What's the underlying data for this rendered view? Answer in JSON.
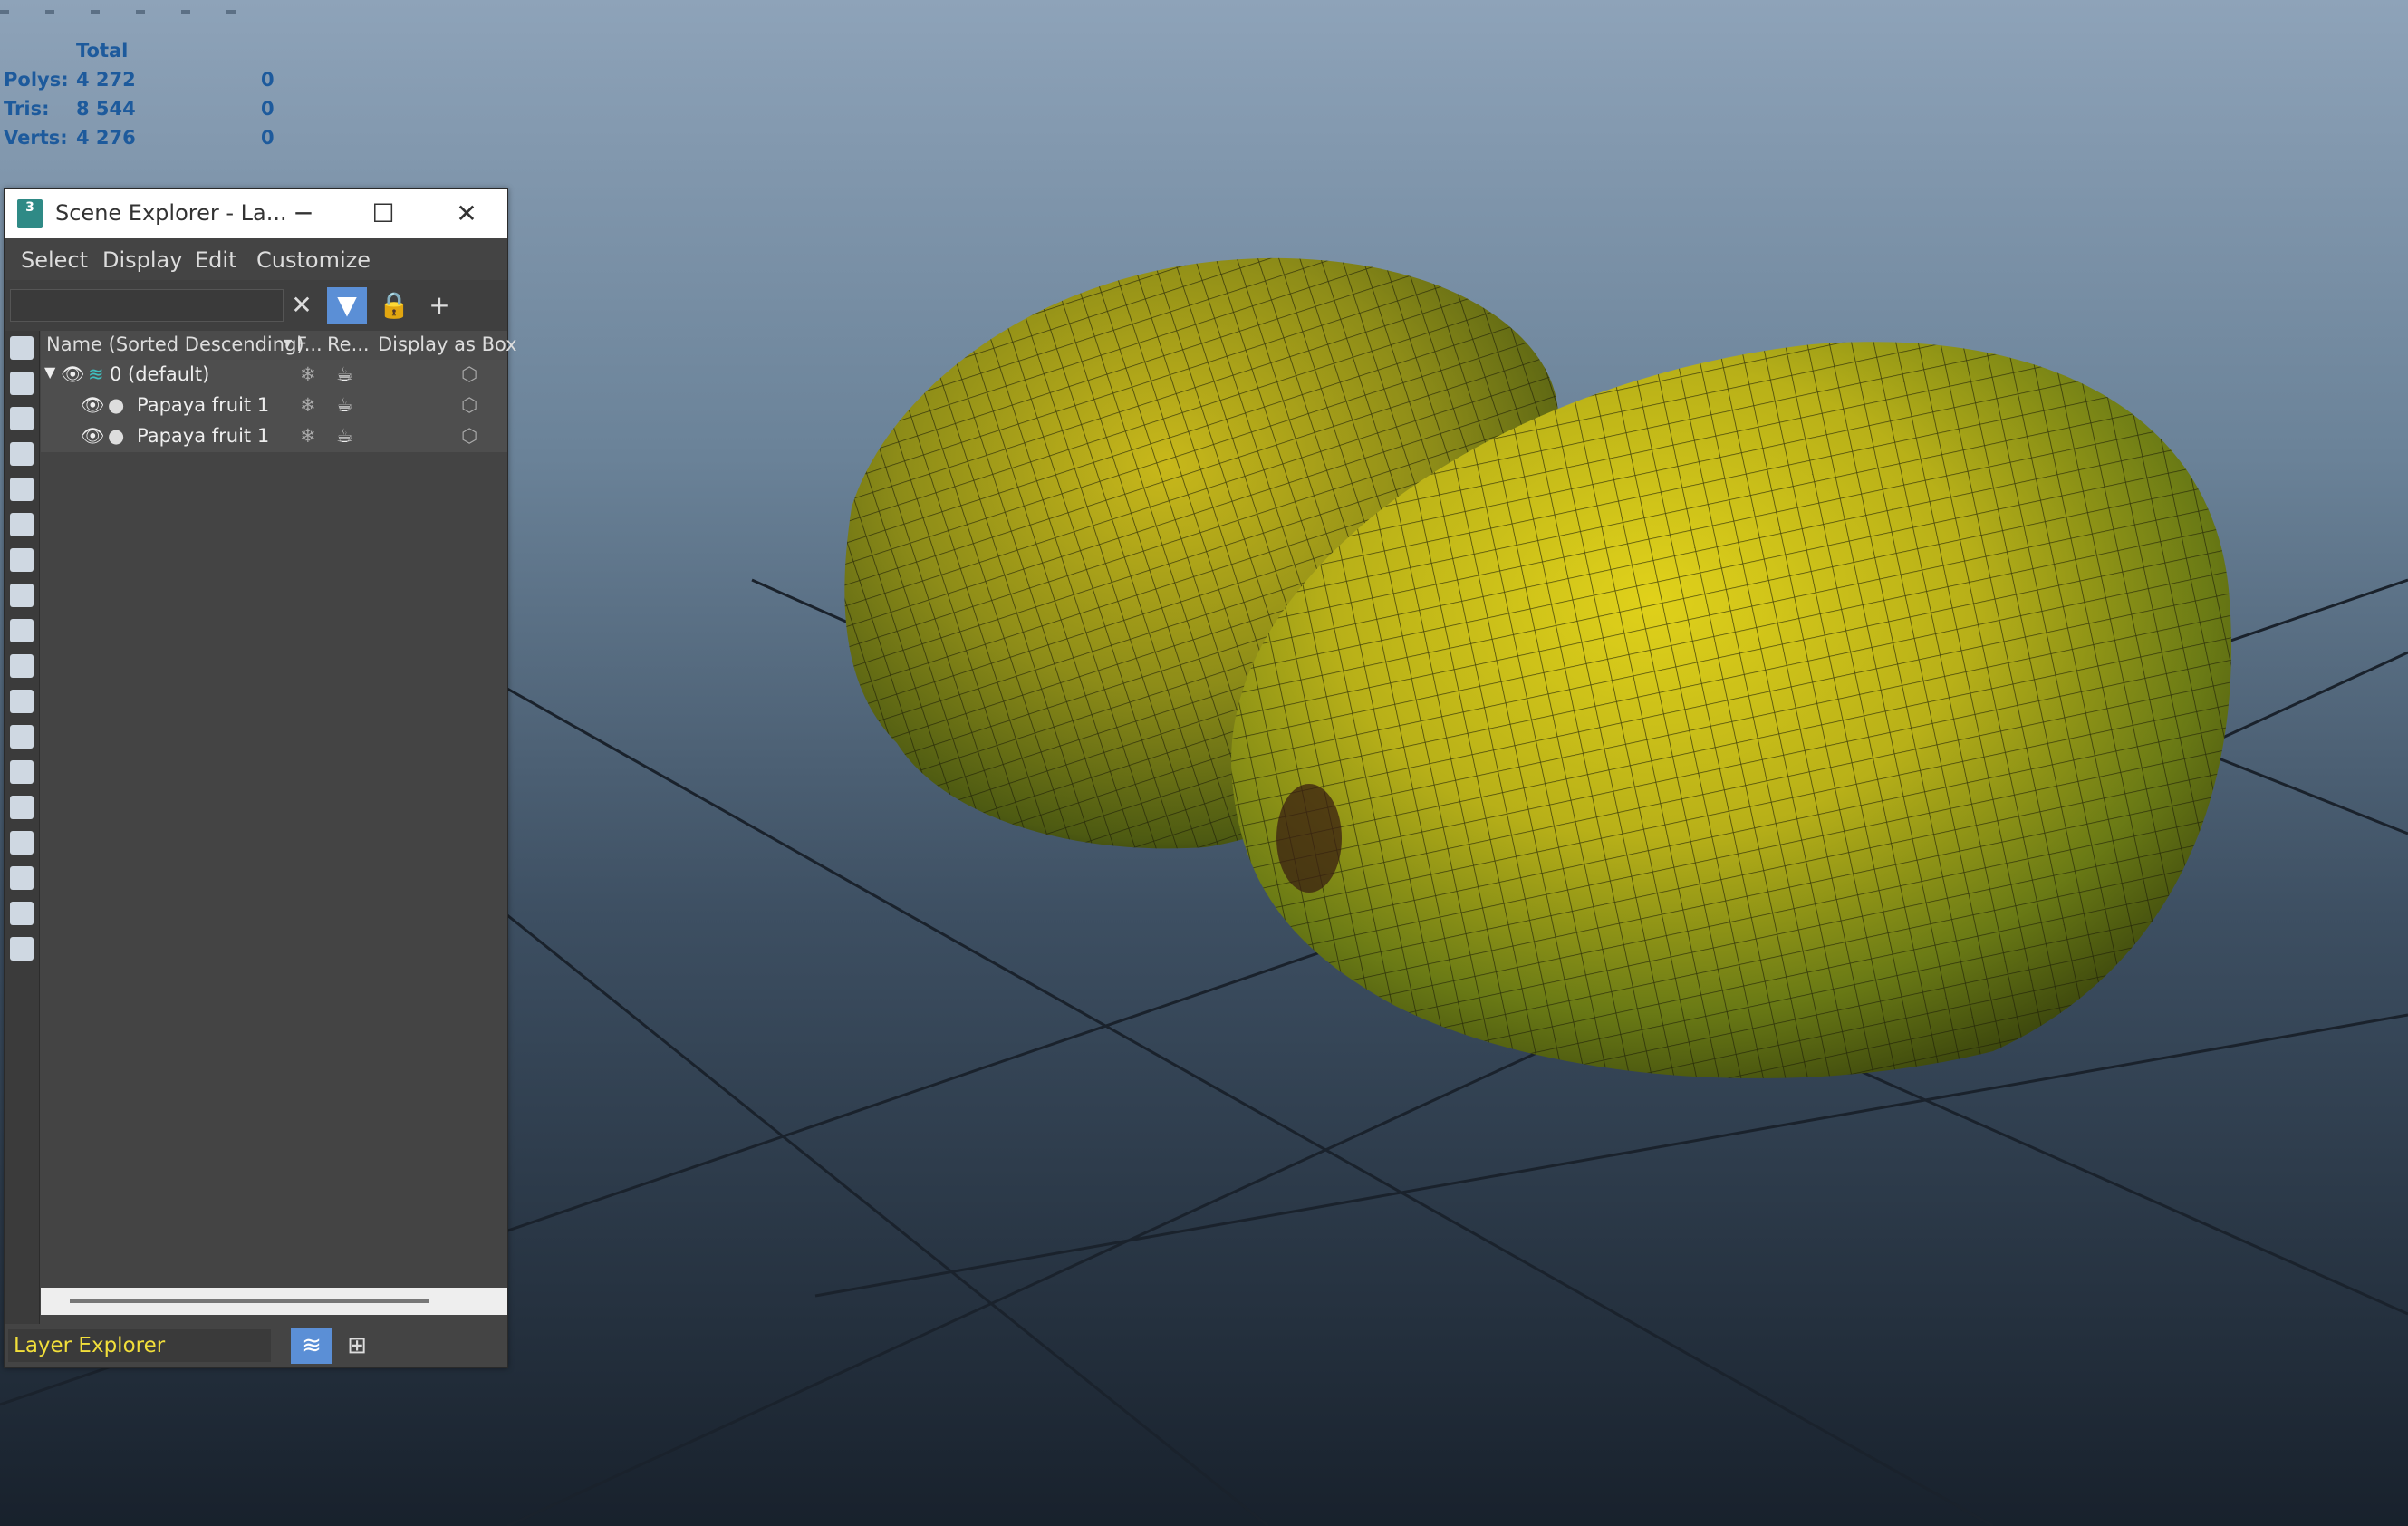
{
  "stats": {
    "header": "Total",
    "rows": [
      {
        "label": "Polys:",
        "total": "4 272",
        "selected": "0"
      },
      {
        "label": "Tris:",
        "total": "8 544",
        "selected": "0"
      },
      {
        "label": "Verts:",
        "total": "4 276",
        "selected": "0"
      }
    ]
  },
  "window": {
    "app_icon_text": "3",
    "title": "Scene Explorer - La...",
    "minimize": "─",
    "maximize": "☐",
    "close": "✕"
  },
  "menu": [
    "Select",
    "Display",
    "Edit",
    "Customize"
  ],
  "toolbar": {
    "clear_icon": "✕",
    "filter_icon": "▼",
    "lock_icon": "🔒",
    "add_layer_icon": "+"
  },
  "columns": [
    "Name (Sorted Descending)",
    "F...",
    "Re...",
    "Display as Box"
  ],
  "tree": [
    {
      "name": "0 (default)",
      "freeze": "❄",
      "render": "☕",
      "box": "⬡"
    },
    {
      "name": "Papaya fruit 1",
      "freeze": "❄",
      "render": "☕",
      "box": "⬡"
    },
    {
      "name": "Papaya fruit 1",
      "freeze": "❄",
      "render": "☕",
      "box": "⬡"
    }
  ],
  "icons": {
    "expand": "▼",
    "visible": "👁",
    "layer": "≋",
    "object": "●",
    "sort": "▾"
  },
  "bottom": {
    "explorer_type": "Layer Explorer",
    "layers_icon": "≋",
    "hierarchy_icon": "⊞"
  },
  "colors": {
    "viewport_top": "#8ea3b9",
    "viewport_bottom": "#18212c",
    "stats_text": "#1d5a9c",
    "accent_blue": "#5b8fd6",
    "explorer_type_text": "#f2df3a",
    "papaya_yellow": "#c8b81a",
    "papaya_green": "#4d6a12"
  }
}
